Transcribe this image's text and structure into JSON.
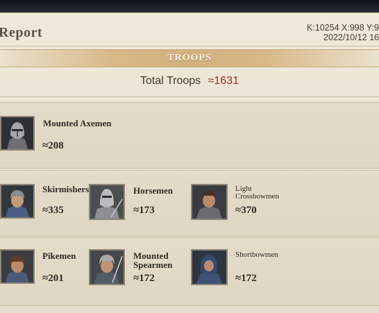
{
  "header": {
    "title": "Report",
    "coords": "K:10254 X:998 Y:9",
    "timestamp": "2022/10/12 16"
  },
  "banner": {
    "label": "TROOPS"
  },
  "total": {
    "label": "Total Troops",
    "value": "≈1631"
  },
  "units": [
    {
      "name": "Mounted Axemen",
      "count": "≈208",
      "icon": "axeman-portrait"
    },
    {
      "name": "Skirmishers",
      "count": "≈335",
      "icon": "skirmisher-portrait"
    },
    {
      "name": "Horsemen",
      "count": "≈173",
      "icon": "horseman-portrait"
    },
    {
      "name": "Light Crossbowmen",
      "count": "≈370",
      "icon": "crossbowman-portrait"
    },
    {
      "name": "Pikemen",
      "count": "≈201",
      "icon": "pikeman-portrait"
    },
    {
      "name": "Mounted Spearmen",
      "count": "≈172",
      "icon": "spearman-portrait"
    },
    {
      "name": "Shortbowmen",
      "count": "≈172",
      "icon": "shortbowman-portrait"
    }
  ],
  "colors": {
    "accent": "#9a2a25",
    "banner": "#d2b080",
    "panel": "#efe9db"
  }
}
